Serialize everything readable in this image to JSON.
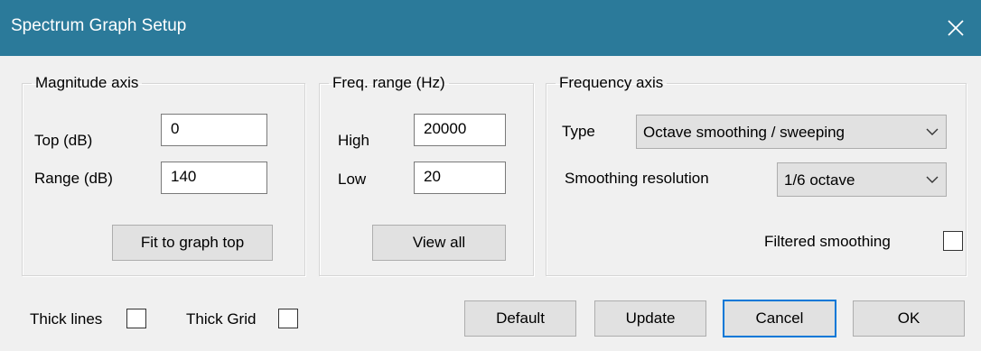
{
  "window": {
    "title": "Spectrum Graph Setup",
    "title_bar_color": "#2b7a9a"
  },
  "magnitude_axis": {
    "legend": "Magnitude axis",
    "top_label": "Top (dB)",
    "top_value": "0",
    "range_label": "Range (dB)",
    "range_value": "140",
    "fit_button": "Fit to graph top"
  },
  "freq_range": {
    "legend": "Freq. range (Hz)",
    "high_label": "High",
    "high_value": "20000",
    "low_label": "Low",
    "low_value": "20",
    "view_all_button": "View all"
  },
  "frequency_axis": {
    "legend": "Frequency axis",
    "type_label": "Type",
    "type_value": "Octave smoothing / sweeping",
    "smoothing_label": "Smoothing resolution",
    "smoothing_value": "1/6 octave",
    "filtered_label": "Filtered smoothing",
    "filtered_checked": false
  },
  "options": {
    "thick_lines_label": "Thick lines",
    "thick_lines_checked": false,
    "thick_grid_label": "Thick Grid",
    "thick_grid_checked": false
  },
  "buttons": {
    "default": "Default",
    "update": "Update",
    "cancel": "Cancel",
    "ok": "OK"
  },
  "icons": {
    "close": "close-icon",
    "dropdown": "chevron-down-icon"
  },
  "colors": {
    "focus_border": "#0078d7"
  }
}
